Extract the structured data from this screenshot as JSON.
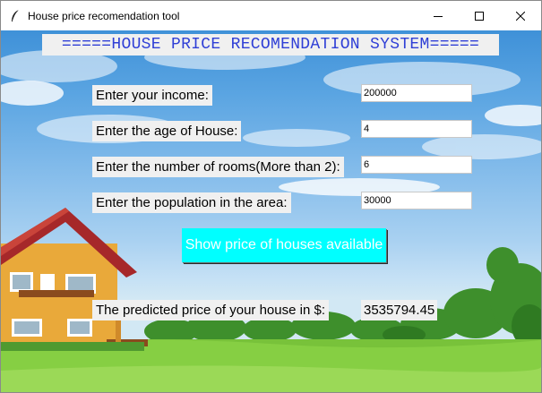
{
  "window": {
    "title": "House price recomendation tool",
    "app_icon": "feather-icon",
    "controls": [
      "minimize-icon",
      "maximize-icon",
      "close-icon"
    ]
  },
  "banner": "=====HOUSE PRICE RECOMENDATION SYSTEM=====",
  "fields": {
    "income": {
      "label": "Enter your income:",
      "value": "200000"
    },
    "age": {
      "label": "Enter the age of House:",
      "value": "4"
    },
    "rooms": {
      "label": "Enter the number of rooms(More than 2):",
      "value": "6"
    },
    "population": {
      "label": "Enter the population in the area:",
      "value": "30000"
    }
  },
  "show_button": "Show price of houses available",
  "result": {
    "label": "The predicted price of your house in $:",
    "value": "3535794.45"
  },
  "colors": {
    "banner_text": "#2f3fd6",
    "button_bg": "#00ffff",
    "button_text": "#ffffff",
    "label_bg": "#f0f0f0"
  }
}
